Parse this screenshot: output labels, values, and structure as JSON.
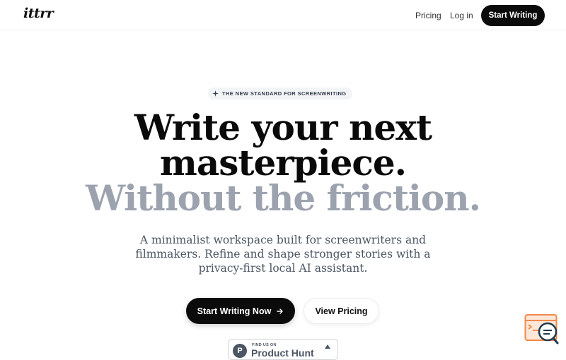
{
  "nav": {
    "logo": "ittrr",
    "links": [
      {
        "label": "Pricing"
      },
      {
        "label": "Log in"
      }
    ],
    "cta_label": "Start Writing"
  },
  "hero": {
    "badge": {
      "icon": "sparkle-icon",
      "text": "THE NEW STANDARD FOR SCREENWRITING"
    },
    "headline_line1": "Write your next",
    "headline_line2": "masterpiece.",
    "headline_line3": "Without the friction.",
    "subtitle": "A minimalist workspace built for screenwriters and filmmakers. Refine and shape stronger stories with a privacy-first local AI assistant.",
    "primary_cta": {
      "label": "Start Writing Now",
      "icon": "arrow-right-icon"
    },
    "secondary_cta": {
      "label": "View Pricing"
    }
  },
  "product_hunt": {
    "small_text": "FIND US ON",
    "big_text": "Product Hunt",
    "logo_letter": "P",
    "icon": "upvote-triangle-icon"
  },
  "floating_widget": {
    "icon": "search-chat-icon"
  },
  "colors": {
    "primary": "#0b0b0b",
    "muted_headline": "#9ca3af",
    "widget_accent": "#f08a4b",
    "widget_dark": "#1f3b4d"
  }
}
